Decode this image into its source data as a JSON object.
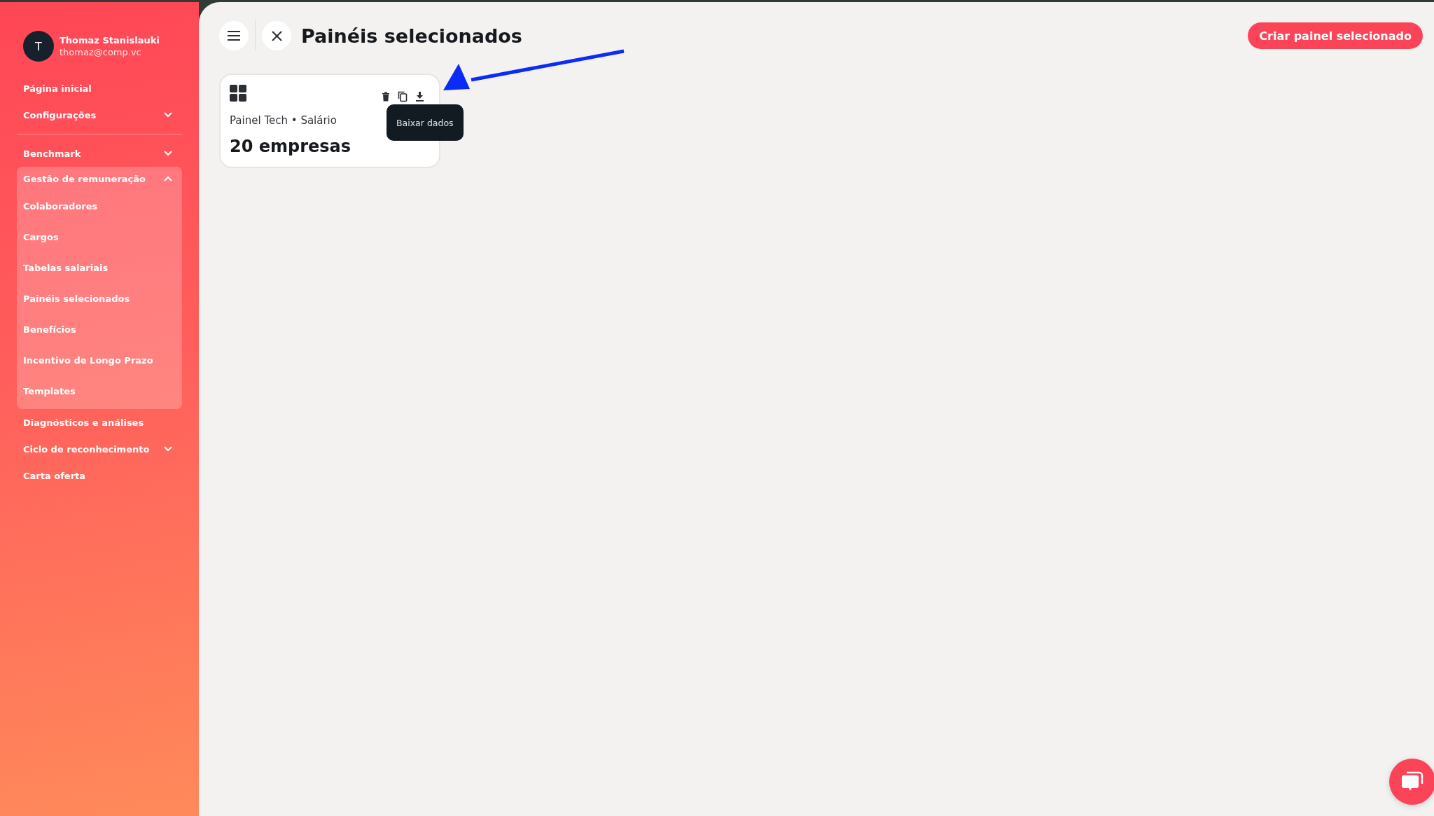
{
  "user": {
    "initial": "T",
    "name": "Thomaz Stanislauki",
    "email": "thomaz@comp.vc"
  },
  "nav": [
    {
      "kind": "link",
      "label": "Página inicial"
    },
    {
      "kind": "dropdown",
      "label": "Configurações",
      "expanded": false
    },
    {
      "kind": "divider"
    },
    {
      "kind": "dropdown",
      "label": "Benchmark",
      "expanded": false
    },
    {
      "kind": "group",
      "label": "Gestão de remuneração",
      "expanded": true,
      "children": [
        {
          "label": "Colaboradores"
        },
        {
          "label": "Cargos"
        },
        {
          "label": "Tabelas salariais"
        },
        {
          "label": "Painéis selecionados"
        },
        {
          "label": "Benefícios"
        },
        {
          "label": "Incentivo de Longo Prazo"
        },
        {
          "label": "Templates"
        }
      ]
    },
    {
      "kind": "link",
      "label": "Diagnósticos e análises"
    },
    {
      "kind": "dropdown",
      "label": "Ciclo de reconhecimento",
      "expanded": false
    },
    {
      "kind": "link",
      "label": "Carta oferta"
    }
  ],
  "page": {
    "title": "Painéis selecionados",
    "create_button": "Criar painel selecionado"
  },
  "cards": [
    {
      "subtitle": "Painel Tech • Salário",
      "count": "20 empresas",
      "actions": [
        {
          "kind": "delete"
        },
        {
          "kind": "copy"
        },
        {
          "kind": "download",
          "tooltip": "Baixar dados"
        }
      ]
    }
  ]
}
